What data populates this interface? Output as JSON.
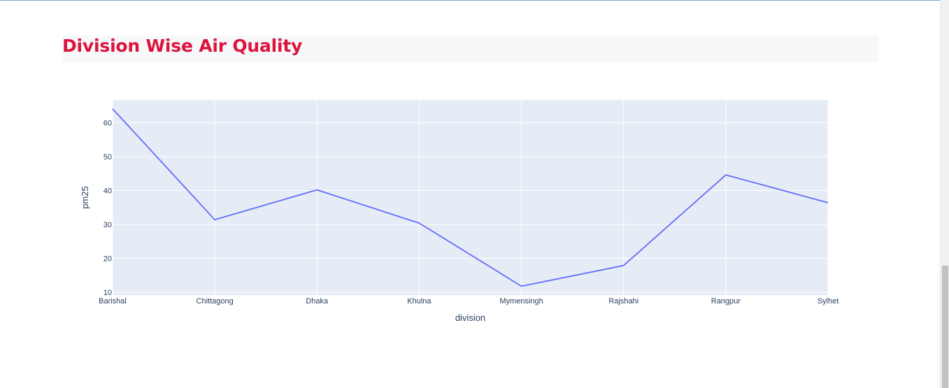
{
  "section": {
    "title": "Division Wise Air Quality"
  },
  "colors": {
    "title": "#dc143c",
    "plot_bg": "#e5ecf6",
    "line": "#636efa",
    "grid": "#ffffff",
    "tick_text": "#2a3f5f"
  },
  "chart_data": {
    "type": "line",
    "categories": [
      "Barishal",
      "Chittagong",
      "Dhaka",
      "Khulna",
      "Mymensingh",
      "Rajshahi",
      "Rangpur",
      "Sylhet"
    ],
    "series": [
      {
        "values": [
          64.1,
          31.4,
          40.2,
          30.4,
          11.8,
          17.9,
          44.6,
          36.4
        ]
      }
    ],
    "xlabel": "division",
    "ylabel": "pm25",
    "ylim": [
      9.2,
      66.7
    ],
    "yticks": [
      10,
      20,
      30,
      40,
      50,
      60
    ],
    "grid": true,
    "legend": "none"
  }
}
